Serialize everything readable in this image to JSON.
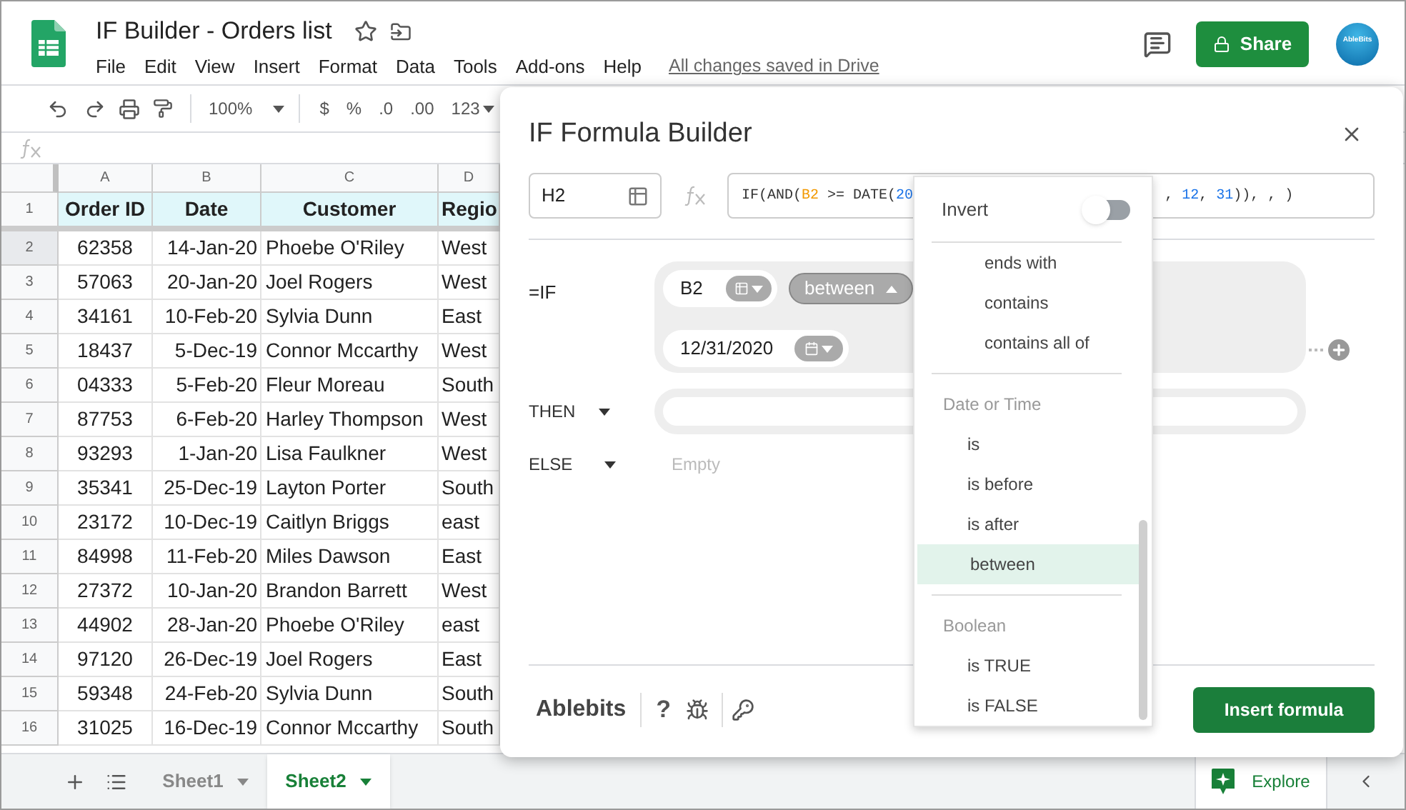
{
  "doc": {
    "title": "IF Builder - Orders list",
    "menu": [
      "File",
      "Edit",
      "View",
      "Insert",
      "Format",
      "Data",
      "Tools",
      "Add-ons",
      "Help"
    ],
    "saved_status": "All changes saved in Drive",
    "share": "Share",
    "avatar": "AbleBits"
  },
  "toolbar": {
    "zoom": "100%",
    "format_buttons": [
      "$",
      "%",
      ".0",
      ".00",
      "123"
    ]
  },
  "sheet": {
    "columns": [
      "A",
      "B",
      "C",
      "D"
    ],
    "header": {
      "number": "1",
      "cells": [
        "Order ID",
        "Date",
        "Customer",
        "Regio"
      ]
    },
    "rows": [
      {
        "number": "2",
        "selected": true,
        "cells": [
          "62358",
          "14-Jan-20",
          "Phoebe O'Riley",
          "West"
        ]
      },
      {
        "number": "3",
        "selected": false,
        "cells": [
          "57063",
          "20-Jan-20",
          "Joel Rogers",
          "West"
        ]
      },
      {
        "number": "4",
        "selected": false,
        "cells": [
          "34161",
          "10-Feb-20",
          "Sylvia Dunn",
          "East"
        ]
      },
      {
        "number": "5",
        "selected": false,
        "cells": [
          "18437",
          "5-Dec-19",
          "Connor Mccarthy",
          "West"
        ]
      },
      {
        "number": "6",
        "selected": false,
        "cells": [
          "04333",
          "5-Feb-20",
          "Fleur Moreau",
          "South"
        ]
      },
      {
        "number": "7",
        "selected": false,
        "cells": [
          "87753",
          "6-Feb-20",
          "Harley Thompson",
          "West"
        ]
      },
      {
        "number": "8",
        "selected": false,
        "cells": [
          "93293",
          "1-Jan-20",
          "Lisa Faulkner",
          "West"
        ]
      },
      {
        "number": "9",
        "selected": false,
        "cells": [
          "35341",
          "25-Dec-19",
          "Layton Porter",
          "South"
        ]
      },
      {
        "number": "10",
        "selected": false,
        "cells": [
          "23172",
          "10-Dec-19",
          "Caitlyn Briggs",
          "east"
        ]
      },
      {
        "number": "11",
        "selected": false,
        "cells": [
          "84998",
          "11-Feb-20",
          "Miles Dawson",
          "East"
        ]
      },
      {
        "number": "12",
        "selected": false,
        "cells": [
          "27372",
          "10-Jan-20",
          "Brandon Barrett",
          "West"
        ]
      },
      {
        "number": "13",
        "selected": false,
        "cells": [
          "44902",
          "28-Jan-20",
          "Phoebe O'Riley",
          "east"
        ]
      },
      {
        "number": "14",
        "selected": false,
        "cells": [
          "97120",
          "26-Dec-19",
          "Joel Rogers",
          "East"
        ]
      },
      {
        "number": "15",
        "selected": false,
        "cells": [
          "59348",
          "24-Feb-20",
          "Sylvia Dunn",
          "South"
        ]
      },
      {
        "number": "16",
        "selected": false,
        "cells": [
          "31025",
          "16-Dec-19",
          "Connor Mccarthy",
          "South"
        ]
      }
    ]
  },
  "sheet_tabs": [
    {
      "label": "Sheet1",
      "selected": false
    },
    {
      "label": "Sheet2",
      "selected": true
    }
  ],
  "explore": "Explore",
  "dialog": {
    "title": "IF Formula Builder",
    "cell_ref": "H2",
    "formula_left": [
      {
        "kind": "fn",
        "text": "IF(AND("
      },
      {
        "kind": "ref",
        "text": "B2"
      },
      {
        "kind": "fn",
        "text": " >= DATE("
      },
      {
        "kind": "num",
        "text": "20"
      }
    ],
    "formula_right": [
      {
        "kind": "fn",
        "text": ", "
      },
      {
        "kind": "num",
        "text": "12"
      },
      {
        "kind": "fn",
        "text": ", "
      },
      {
        "kind": "num",
        "text": "31"
      },
      {
        "kind": "fn",
        "text": ")), , )"
      }
    ],
    "if_label": "=IF",
    "condition": {
      "cell": "B2",
      "operator": "between",
      "operator_expanded": true,
      "value": "12/31/2020"
    },
    "then_label": "THEN",
    "else_label": "ELSE",
    "else_placeholder": "Empty",
    "brand": "Ablebits",
    "help": "?",
    "insert": "Insert formula"
  },
  "dropdown": {
    "invert": {
      "label": "Invert",
      "on": false
    },
    "groups": [
      {
        "items": [
          {
            "label": "ends with",
            "selected": false
          },
          {
            "label": "contains",
            "selected": false
          },
          {
            "label": "contains all of",
            "selected": false
          }
        ]
      },
      {
        "header": "Date or Time",
        "items": [
          {
            "label": "is",
            "selected": false
          },
          {
            "label": "is before",
            "selected": false
          },
          {
            "label": "is after",
            "selected": false
          },
          {
            "label": "between",
            "selected": true
          }
        ]
      },
      {
        "header": "Boolean",
        "items": [
          {
            "label": "is TRUE",
            "selected": false
          },
          {
            "label": "is FALSE",
            "selected": false
          }
        ]
      }
    ]
  }
}
